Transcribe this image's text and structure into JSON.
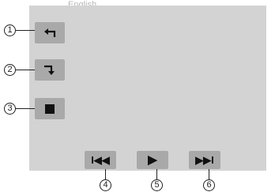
{
  "header_text": "English",
  "controls": {
    "undo": {
      "icon": "undo-arrow-icon"
    },
    "redo": {
      "icon": "redo-arrow-icon"
    },
    "stop": {
      "icon": "stop-icon"
    },
    "previous": {
      "glyph": "I◀◀",
      "icon": "skip-previous-icon"
    },
    "play": {
      "glyph": "▶",
      "icon": "play-icon"
    },
    "next": {
      "glyph": "▶▶I",
      "icon": "skip-next-icon"
    }
  },
  "callouts": [
    "1",
    "2",
    "3",
    "4",
    "5",
    "6"
  ],
  "colors": {
    "screen": "#d3d3d3",
    "button": "#a9a9a9",
    "icon": "#111111",
    "callout_line": "#222222"
  }
}
